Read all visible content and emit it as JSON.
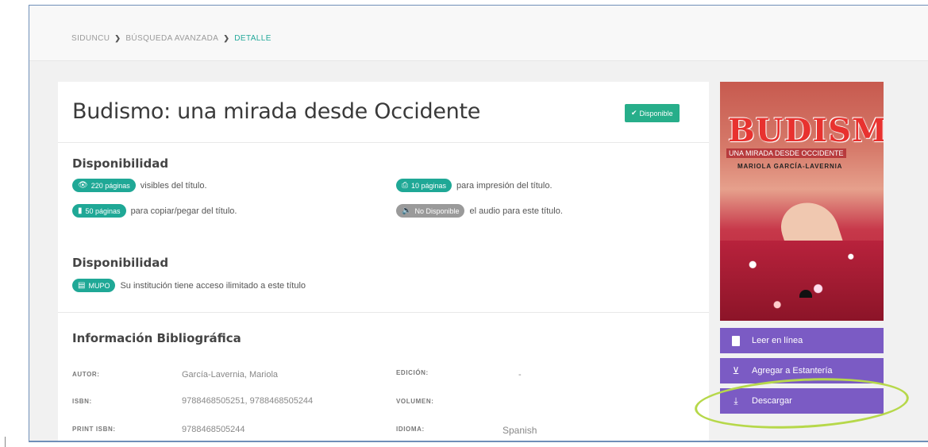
{
  "breadcrumb": {
    "items": [
      "SIDUNCU",
      "BÚSQUEDA AVANZADA",
      "DETALLE"
    ],
    "separator": "❯"
  },
  "book": {
    "title": "Budismo: una mirada desde Occidente",
    "status_badge": "Disponible",
    "status_icon": "check-icon"
  },
  "availability": {
    "heading": "Disponibilidad",
    "items": [
      {
        "badge": "220 páginas",
        "text": "visibles del título.",
        "icon": "eye-icon",
        "enabled": true
      },
      {
        "badge": "10 páginas",
        "text": "para impresión del título.",
        "icon": "printer-icon",
        "enabled": true
      },
      {
        "badge": "50 páginas",
        "text": "para copiar/pegar del título.",
        "icon": "copy-icon",
        "enabled": true
      },
      {
        "badge": "No Disponible",
        "text": "el audio para este título.",
        "icon": "speaker-icon",
        "enabled": false
      }
    ]
  },
  "license": {
    "heading": "Disponibilidad",
    "badge": "MUPO",
    "badge_icon": "book-icon",
    "text": "Su institución tiene acceso ilimitado a este título"
  },
  "bibliographic": {
    "heading": "Información Bibliográfica",
    "fields": [
      {
        "label": "AUTOR:",
        "value": "García-Lavernia, Mariola"
      },
      {
        "label": "EDICIÓN:",
        "value": "-"
      },
      {
        "label": "ISBN:",
        "value": "9788468505251, 9788468505244"
      },
      {
        "label": "VOLUMEN:",
        "value": ""
      },
      {
        "label": "PRINT ISBN:",
        "value": "9788468505244"
      },
      {
        "label": "IDIOMA:",
        "value": "Spanish"
      }
    ]
  },
  "cover": {
    "title": "BUDISMO",
    "subtitle": "UNA MIRADA DESDE OCCIDENTE",
    "author": "MARIOLA GARCÍA-LAVERNIA"
  },
  "actions": [
    {
      "label": "Leer en línea",
      "icon": "document-icon"
    },
    {
      "label": "Agregar a Estantería",
      "icon": "bookshelf-icon"
    },
    {
      "label": "Descargar",
      "icon": "download-icon"
    }
  ],
  "colors": {
    "teal": "#1fa896",
    "green_badge": "#27ae8a",
    "purple_button": "#7b5bc4",
    "highlight": "#b6d84a",
    "frame_border": "#6f8fb8"
  }
}
